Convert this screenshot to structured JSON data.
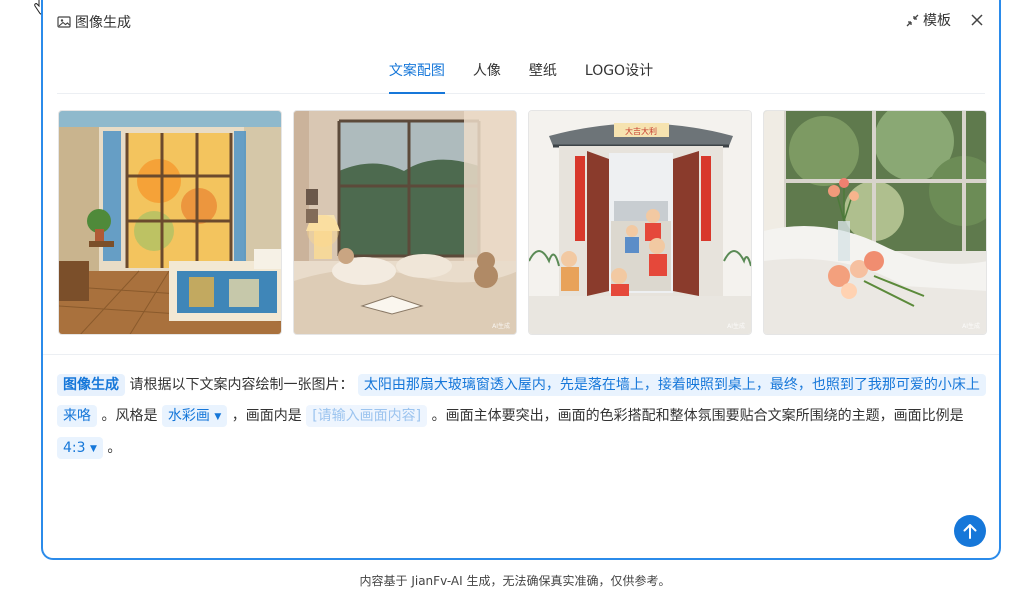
{
  "header": {
    "title": "图像生成",
    "template_label": "模板"
  },
  "tabs": [
    {
      "label": "文案配图"
    },
    {
      "label": "人像"
    },
    {
      "label": "壁纸"
    },
    {
      "label": "LOGO设计"
    }
  ],
  "gallery": {
    "watermark": "AI生成"
  },
  "prompt": {
    "title_chip": "图像生成",
    "intro": "请根据以下文案内容绘制一张图片：",
    "copy_text": "太阳由那扇大玻璃窗透入屋内，先是落在墙上，接着映照到桌上，最终，也照到了我那可爱的小床上来咯",
    "style_prefix": "。风格是",
    "style_value": "水彩画",
    "content_prefix": "，画面内是",
    "content_placeholder": "[请输入画面内容]",
    "middle": "。画面主体要突出，画面的色彩搭配和整体氛围要贴合文案所围绕的主题，画面比例是",
    "ratio_value": "4:3",
    "end": "。"
  },
  "footer": "内容基于 JianFv-AI 生成，无法确保真实准确，仅供参考。",
  "colors": {
    "accent": "#1677d9",
    "border": "#2b8bea"
  }
}
